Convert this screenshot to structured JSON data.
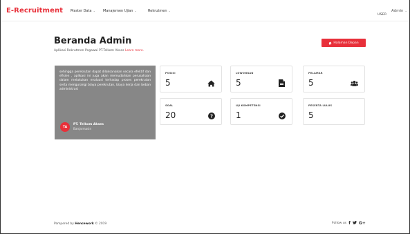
{
  "nav": {
    "brand": "E-Recruitment",
    "items": [
      {
        "label": "Master Data",
        "caret": "⌄"
      },
      {
        "label": "Manajemen Ujian",
        "caret": "⌄"
      },
      {
        "label": "Rekrutmen",
        "caret": "⌄"
      }
    ],
    "role_label": "USER",
    "user_label": "Admin",
    "user_caret": "⌄"
  },
  "header": {
    "title": "Beranda Admin",
    "subtitle": "Aplikasi Rekrutmen Pegawai PT.Telkom Akses",
    "subtitle_link": "Learn more.",
    "home_button_icon": "home-icon",
    "home_button_label": "Halaman Depan"
  },
  "info_card": {
    "text": "sehingga perekrutan dapat dilaksanakan secara efektif dan efisien , aplikasi ini juga akan memudahkan perusahaan dalam melakukan evaluasi terhadap proses perekrutan serta mengurangi biaya perekrutan, biaya kerja dan beban administrasi",
    "avatar_initials": "TA",
    "org_name": "PT. Telkom Akses",
    "org_city": "Banjarmasin"
  },
  "stats": [
    {
      "label": "POSISI",
      "value": "5",
      "icon": "home-icon"
    },
    {
      "label": "LOWONGAN",
      "value": "5",
      "icon": "document-icon"
    },
    {
      "label": "PELAMAR",
      "value": "5",
      "icon": "users-icon"
    },
    {
      "label": "SOAL",
      "value": "20",
      "icon": "question-circle-icon"
    },
    {
      "label": "UJI KOMPETENSI",
      "value": "1",
      "icon": "check-circle-icon"
    },
    {
      "label": "PESERTA LULUS",
      "value": "5",
      "icon": ""
    }
  ],
  "footer": {
    "pampered_by": "Pampered by",
    "author": "Hencework",
    "copyright": "© 2019",
    "follow_label": "Follow us",
    "social": [
      "f",
      "🐦",
      "G+"
    ]
  },
  "colors": {
    "accent": "#e8303a",
    "info_card_bg": "#878787"
  }
}
